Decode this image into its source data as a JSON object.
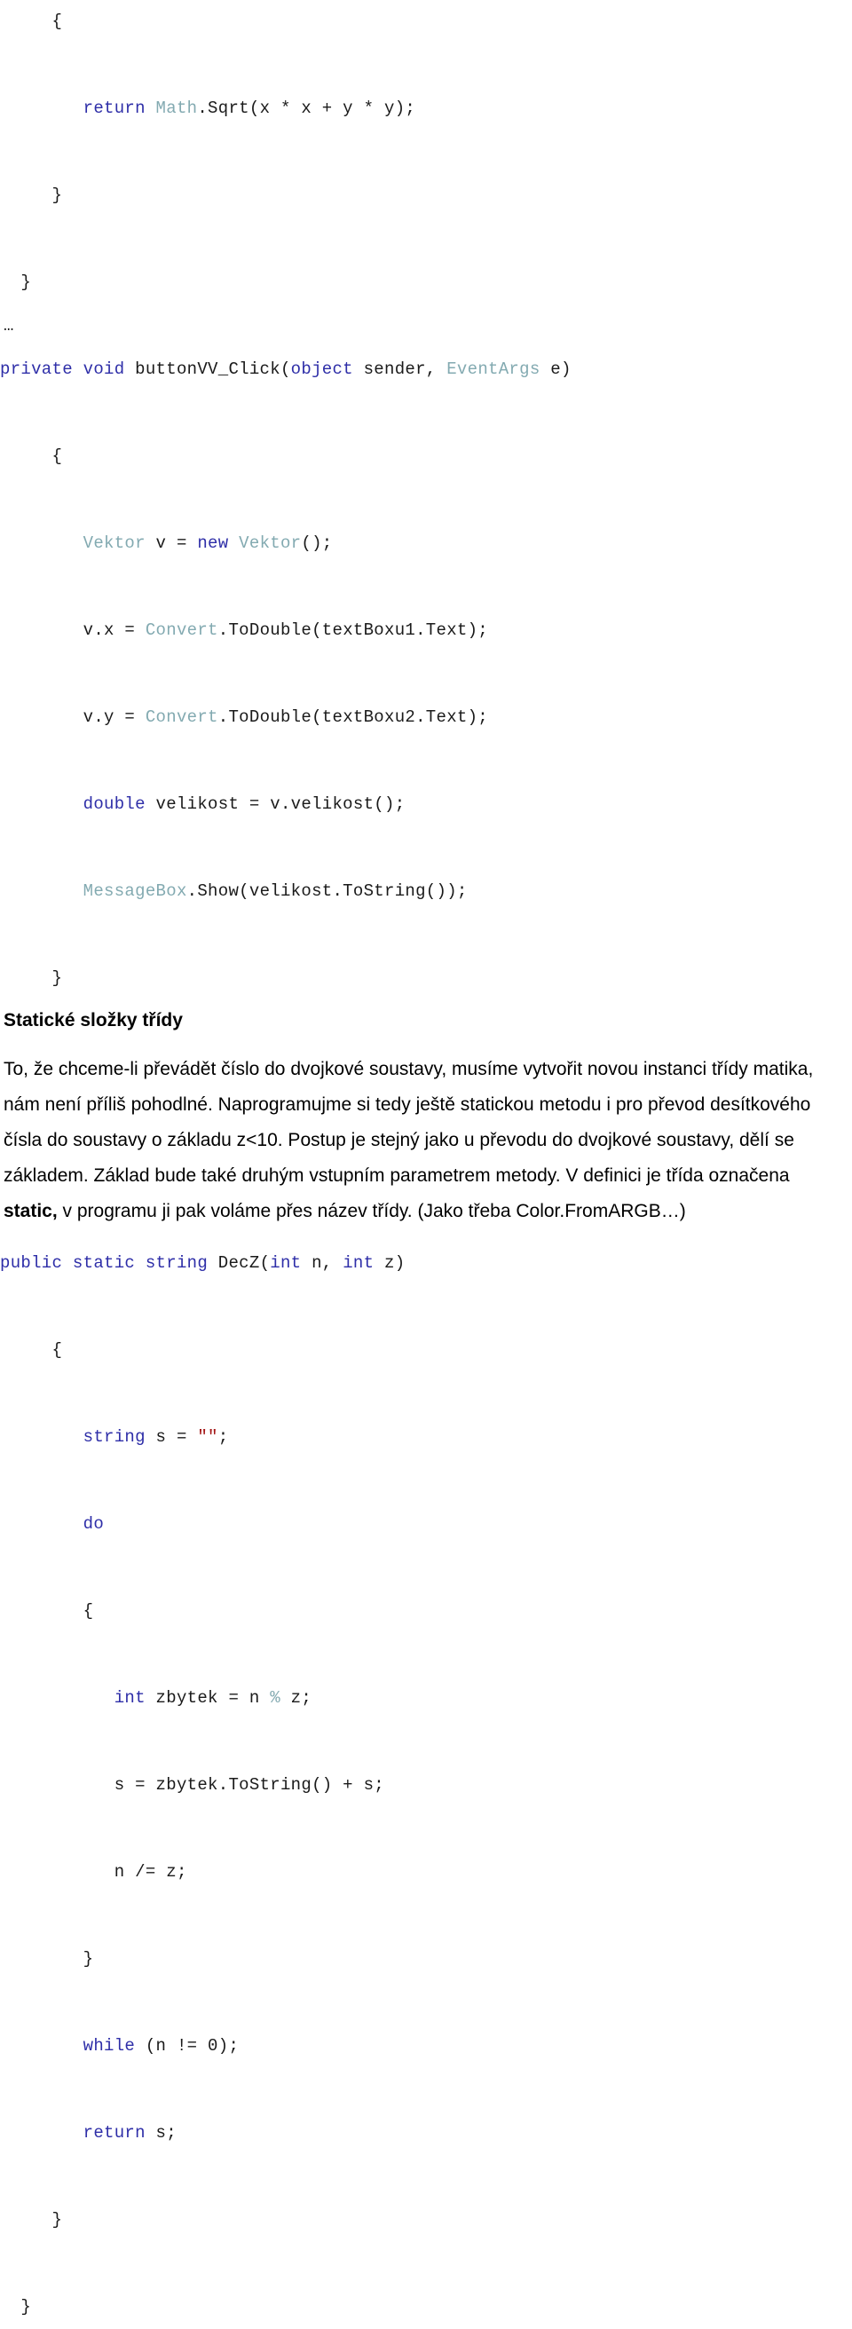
{
  "document": {
    "language": "cs",
    "colors": {
      "keyword": "#2e2ea8",
      "type_name": "#83aab1",
      "string_literal": "#a31515",
      "plain_text": "#1a1a1a",
      "body_text": "#000000",
      "page_background": "#ffffff"
    }
  },
  "code_top": {
    "lines": [
      {
        "indent": 5,
        "tokens": [
          {
            "t": "{",
            "c": "pln"
          }
        ]
      },
      {
        "indent": 0,
        "tokens": []
      },
      {
        "indent": 8,
        "tokens": [
          {
            "t": "return",
            "c": "kw"
          },
          {
            "t": " ",
            "c": "pln"
          },
          {
            "t": "Math",
            "c": "typ"
          },
          {
            "t": ".Sqrt(x * x + y * y);",
            "c": "pln"
          }
        ]
      },
      {
        "indent": 0,
        "tokens": []
      },
      {
        "indent": 5,
        "tokens": [
          {
            "t": "}",
            "c": "pln"
          }
        ]
      },
      {
        "indent": 0,
        "tokens": []
      },
      {
        "indent": 2,
        "tokens": [
          {
            "t": "}",
            "c": "pln"
          }
        ]
      }
    ]
  },
  "ellipsis": "…",
  "code_handler": {
    "lines": [
      {
        "indent": 0,
        "tokens": [
          {
            "t": "private",
            "c": "kw"
          },
          {
            "t": " ",
            "c": "pln"
          },
          {
            "t": "void",
            "c": "kw"
          },
          {
            "t": " buttonVV_Click(",
            "c": "pln"
          },
          {
            "t": "object",
            "c": "kw"
          },
          {
            "t": " sender, ",
            "c": "pln"
          },
          {
            "t": "EventArgs",
            "c": "typ"
          },
          {
            "t": " e)",
            "c": "pln"
          }
        ]
      },
      {
        "indent": 0,
        "tokens": []
      },
      {
        "indent": 5,
        "tokens": [
          {
            "t": "{",
            "c": "pln"
          }
        ]
      },
      {
        "indent": 0,
        "tokens": []
      },
      {
        "indent": 8,
        "tokens": [
          {
            "t": "Vektor",
            "c": "typ"
          },
          {
            "t": " v = ",
            "c": "pln"
          },
          {
            "t": "new",
            "c": "kw"
          },
          {
            "t": " ",
            "c": "pln"
          },
          {
            "t": "Vektor",
            "c": "typ"
          },
          {
            "t": "();",
            "c": "pln"
          }
        ]
      },
      {
        "indent": 0,
        "tokens": []
      },
      {
        "indent": 8,
        "tokens": [
          {
            "t": "v.x = ",
            "c": "pln"
          },
          {
            "t": "Convert",
            "c": "typ"
          },
          {
            "t": ".ToDouble(textBoxu1.Text);",
            "c": "pln"
          }
        ]
      },
      {
        "indent": 0,
        "tokens": []
      },
      {
        "indent": 8,
        "tokens": [
          {
            "t": "v.y = ",
            "c": "pln"
          },
          {
            "t": "Convert",
            "c": "typ"
          },
          {
            "t": ".ToDouble(textBoxu2.Text);",
            "c": "pln"
          }
        ]
      },
      {
        "indent": 0,
        "tokens": []
      },
      {
        "indent": 8,
        "tokens": [
          {
            "t": "double",
            "c": "kw"
          },
          {
            "t": " velikost = v.velikost();",
            "c": "pln"
          }
        ]
      },
      {
        "indent": 0,
        "tokens": []
      },
      {
        "indent": 8,
        "tokens": [
          {
            "t": "MessageBox",
            "c": "typ"
          },
          {
            "t": ".Show(velikost.ToString());",
            "c": "pln"
          }
        ]
      },
      {
        "indent": 0,
        "tokens": []
      },
      {
        "indent": 5,
        "tokens": [
          {
            "t": "}",
            "c": "pln"
          }
        ]
      }
    ]
  },
  "section": {
    "heading": "Statické složky třídy",
    "paragraph_part1": "To, že chceme-li převádět číslo do dvojkové soustavy, musíme vytvořit novou instanci třídy matika, nám není příliš pohodlné. Naprogramujme si tedy ještě statickou metodu i pro převod desítkového čísla do soustavy o základu z<10. Postup je stejný jako u převodu do dvojkové soustavy, dělí se základem. Základ bude také druhým vstupním parametrem metody. V definici je třída označena ",
    "paragraph_bold": "static,",
    "paragraph_part2": " v programu ji pak voláme přes název třídy. (Jako třeba Color.FromARGB…)"
  },
  "code_decz": {
    "lines": [
      {
        "indent": 0,
        "tokens": [
          {
            "t": "public",
            "c": "kw"
          },
          {
            "t": " ",
            "c": "pln"
          },
          {
            "t": "static",
            "c": "kw"
          },
          {
            "t": " ",
            "c": "pln"
          },
          {
            "t": "string",
            "c": "kw"
          },
          {
            "t": " DecZ(",
            "c": "pln"
          },
          {
            "t": "int",
            "c": "kw"
          },
          {
            "t": " n, ",
            "c": "pln"
          },
          {
            "t": "int",
            "c": "kw"
          },
          {
            "t": " z)",
            "c": "pln"
          }
        ]
      },
      {
        "indent": 0,
        "tokens": []
      },
      {
        "indent": 5,
        "tokens": [
          {
            "t": "{",
            "c": "pln"
          }
        ]
      },
      {
        "indent": 0,
        "tokens": []
      },
      {
        "indent": 8,
        "tokens": [
          {
            "t": "string",
            "c": "kw"
          },
          {
            "t": " s = ",
            "c": "pln"
          },
          {
            "t": "\"\"",
            "c": "str"
          },
          {
            "t": ";",
            "c": "pln"
          }
        ]
      },
      {
        "indent": 0,
        "tokens": []
      },
      {
        "indent": 8,
        "tokens": [
          {
            "t": "do",
            "c": "kw"
          }
        ]
      },
      {
        "indent": 0,
        "tokens": []
      },
      {
        "indent": 8,
        "tokens": [
          {
            "t": "{",
            "c": "pln"
          }
        ]
      },
      {
        "indent": 0,
        "tokens": []
      },
      {
        "indent": 11,
        "tokens": [
          {
            "t": "int",
            "c": "kw"
          },
          {
            "t": " zbytek = n ",
            "c": "pln"
          },
          {
            "t": "%",
            "c": "typ"
          },
          {
            "t": " z;",
            "c": "pln"
          }
        ]
      },
      {
        "indent": 0,
        "tokens": []
      },
      {
        "indent": 11,
        "tokens": [
          {
            "t": "s = zbytek.ToString() + s;",
            "c": "pln"
          }
        ]
      },
      {
        "indent": 0,
        "tokens": []
      },
      {
        "indent": 11,
        "tokens": [
          {
            "t": "n /= z;",
            "c": "pln"
          }
        ]
      },
      {
        "indent": 0,
        "tokens": []
      },
      {
        "indent": 8,
        "tokens": [
          {
            "t": "}",
            "c": "pln"
          }
        ]
      },
      {
        "indent": 0,
        "tokens": []
      },
      {
        "indent": 8,
        "tokens": [
          {
            "t": "while",
            "c": "kw"
          },
          {
            "t": " (n != 0);",
            "c": "pln"
          }
        ]
      },
      {
        "indent": 0,
        "tokens": []
      },
      {
        "indent": 8,
        "tokens": [
          {
            "t": "return",
            "c": "kw"
          },
          {
            "t": " s;",
            "c": "pln"
          }
        ]
      },
      {
        "indent": 0,
        "tokens": []
      },
      {
        "indent": 5,
        "tokens": [
          {
            "t": "}",
            "c": "pln"
          }
        ]
      },
      {
        "indent": 0,
        "tokens": []
      },
      {
        "indent": 2,
        "tokens": [
          {
            "t": "}",
            "c": "pln"
          }
        ]
      }
    ]
  }
}
